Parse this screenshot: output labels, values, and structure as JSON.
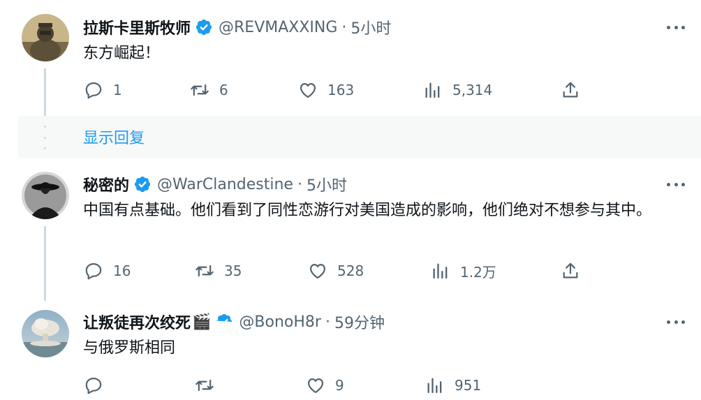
{
  "colors": {
    "verified_badge": "#1d9bf0",
    "secondary_text": "#536471",
    "link": "#1d9bf0",
    "thread_line": "#cfd9de"
  },
  "show_replies_label": "显示回复",
  "tweets": [
    {
      "name": "拉斯卡里斯牧师",
      "handle": "@REVMAXXING",
      "separator": "·",
      "time": "5小时",
      "text": "东方崛起！",
      "verified": true,
      "counts": {
        "reply": "1",
        "retweet": "6",
        "like": "163",
        "views": "5,314"
      }
    },
    {
      "name": "秘密的",
      "handle": "@WarClandestine",
      "separator": "·",
      "time": "5小时",
      "text": "中国有点基础。他们看到了同性恋游行对美国造成的影响，他们绝对不想参与其中。",
      "verified": true,
      "counts": {
        "reply": "16",
        "retweet": "35",
        "like": "528",
        "views": "1.2万"
      }
    },
    {
      "name": "让叛徒再次绞死",
      "name_emoji": "🎬",
      "handle": "@BonoH8r",
      "separator": "·",
      "time": "59分钟",
      "text": "与俄罗斯相同",
      "verified": true,
      "counts": {
        "reply": "",
        "retweet": "",
        "like": "9",
        "views": "951"
      }
    }
  ]
}
